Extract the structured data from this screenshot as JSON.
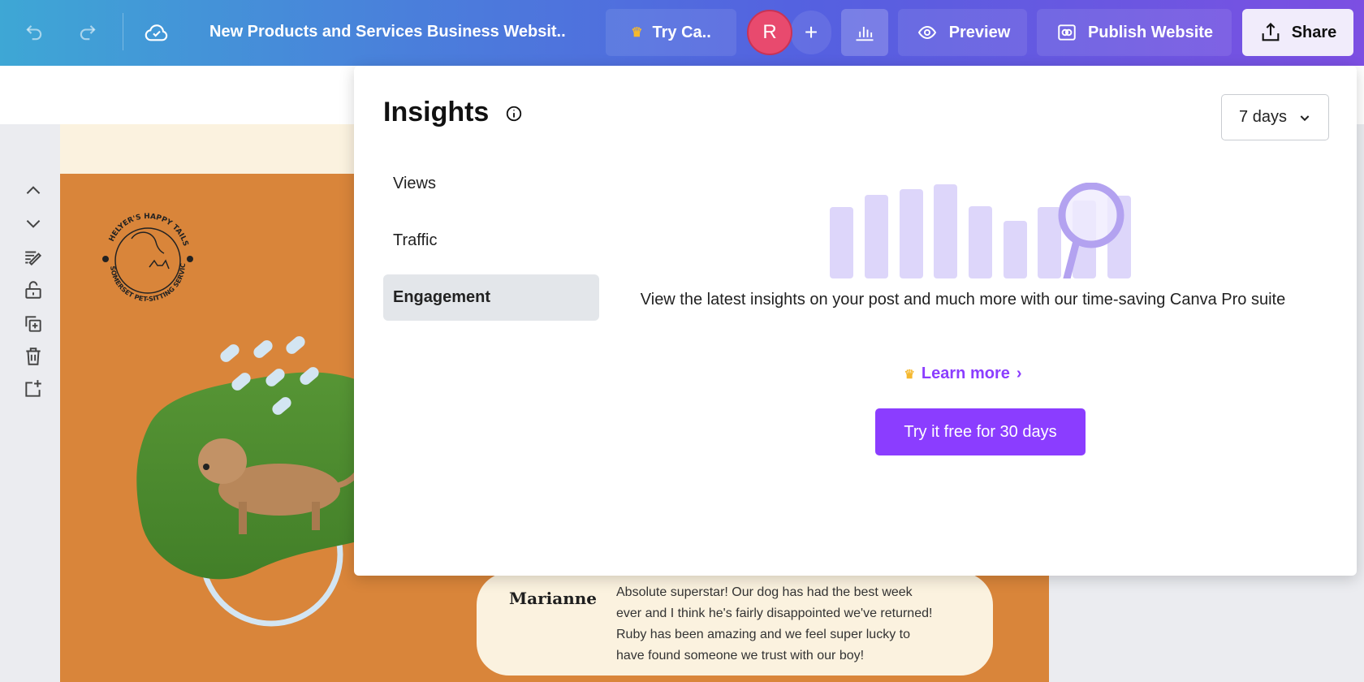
{
  "header": {
    "title": "New Products and Services Business Websit..",
    "try_label": "Try Ca..",
    "avatar_initial": "R",
    "preview_label": "Preview",
    "publish_label": "Publish Website",
    "share_label": "Share"
  },
  "insights": {
    "title": "Insights",
    "range": "7 days",
    "nav": [
      {
        "label": "Views"
      },
      {
        "label": "Traffic"
      },
      {
        "label": "Engagement"
      }
    ],
    "message": "View the latest insights on your post and much more with our time-saving Canva Pro suite",
    "learn_more": "Learn more",
    "cta": "Try it free for 30 days",
    "accent": "#8b3dff"
  },
  "canvas": {
    "logo_text": "HELYER'S HAPPY TAILS · SOMERSET PET-SITTING SERVICES",
    "testimonial": {
      "name": "Marianne",
      "lines": [
        "Absolute superstar! Our dog has had the best week",
        "ever and I think he's fairly disappointed we've returned!",
        "Ruby has been amazing and we feel super lucky to",
        "have found someone we trust with our boy!"
      ]
    }
  }
}
